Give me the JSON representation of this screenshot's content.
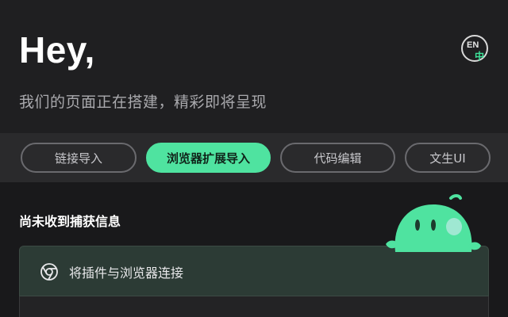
{
  "header": {
    "greeting": "Hey,",
    "subtitle": "我们的页面正在搭建，精彩即将呈现",
    "lang_toggle": {
      "en": "EN",
      "zh": "中"
    }
  },
  "tabs": [
    {
      "label": "链接导入",
      "active": false
    },
    {
      "label": "浏览器扩展导入",
      "active": true
    },
    {
      "label": "代码编辑",
      "active": false
    },
    {
      "label": "文生UI",
      "active": false
    }
  ],
  "main": {
    "section_title": "尚未收到捕获信息",
    "card": {
      "icon": "chrome-icon",
      "label": "将插件与浏览器连接"
    },
    "mascot": "green-blob-mascot"
  },
  "colors": {
    "accent": "#4fe3a0",
    "background": "#1f1f21",
    "card_bg": "#2c3b35"
  }
}
